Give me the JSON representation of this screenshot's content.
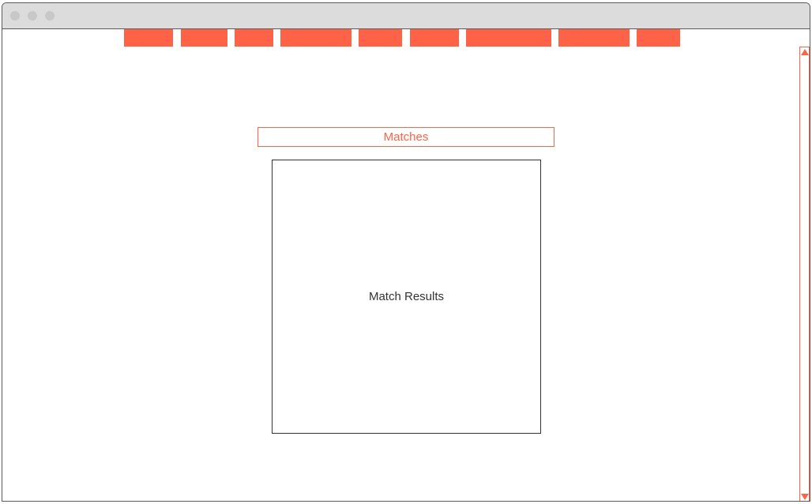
{
  "colors": {
    "accent": "#ff6347",
    "titlebar": "#dcdcdc",
    "border": "#333333"
  },
  "nav": {
    "tabs": [
      "",
      "",
      "",
      "",
      "",
      "",
      "",
      "",
      ""
    ]
  },
  "matches": {
    "header": "Matches",
    "results_placeholder": "Match Results"
  }
}
